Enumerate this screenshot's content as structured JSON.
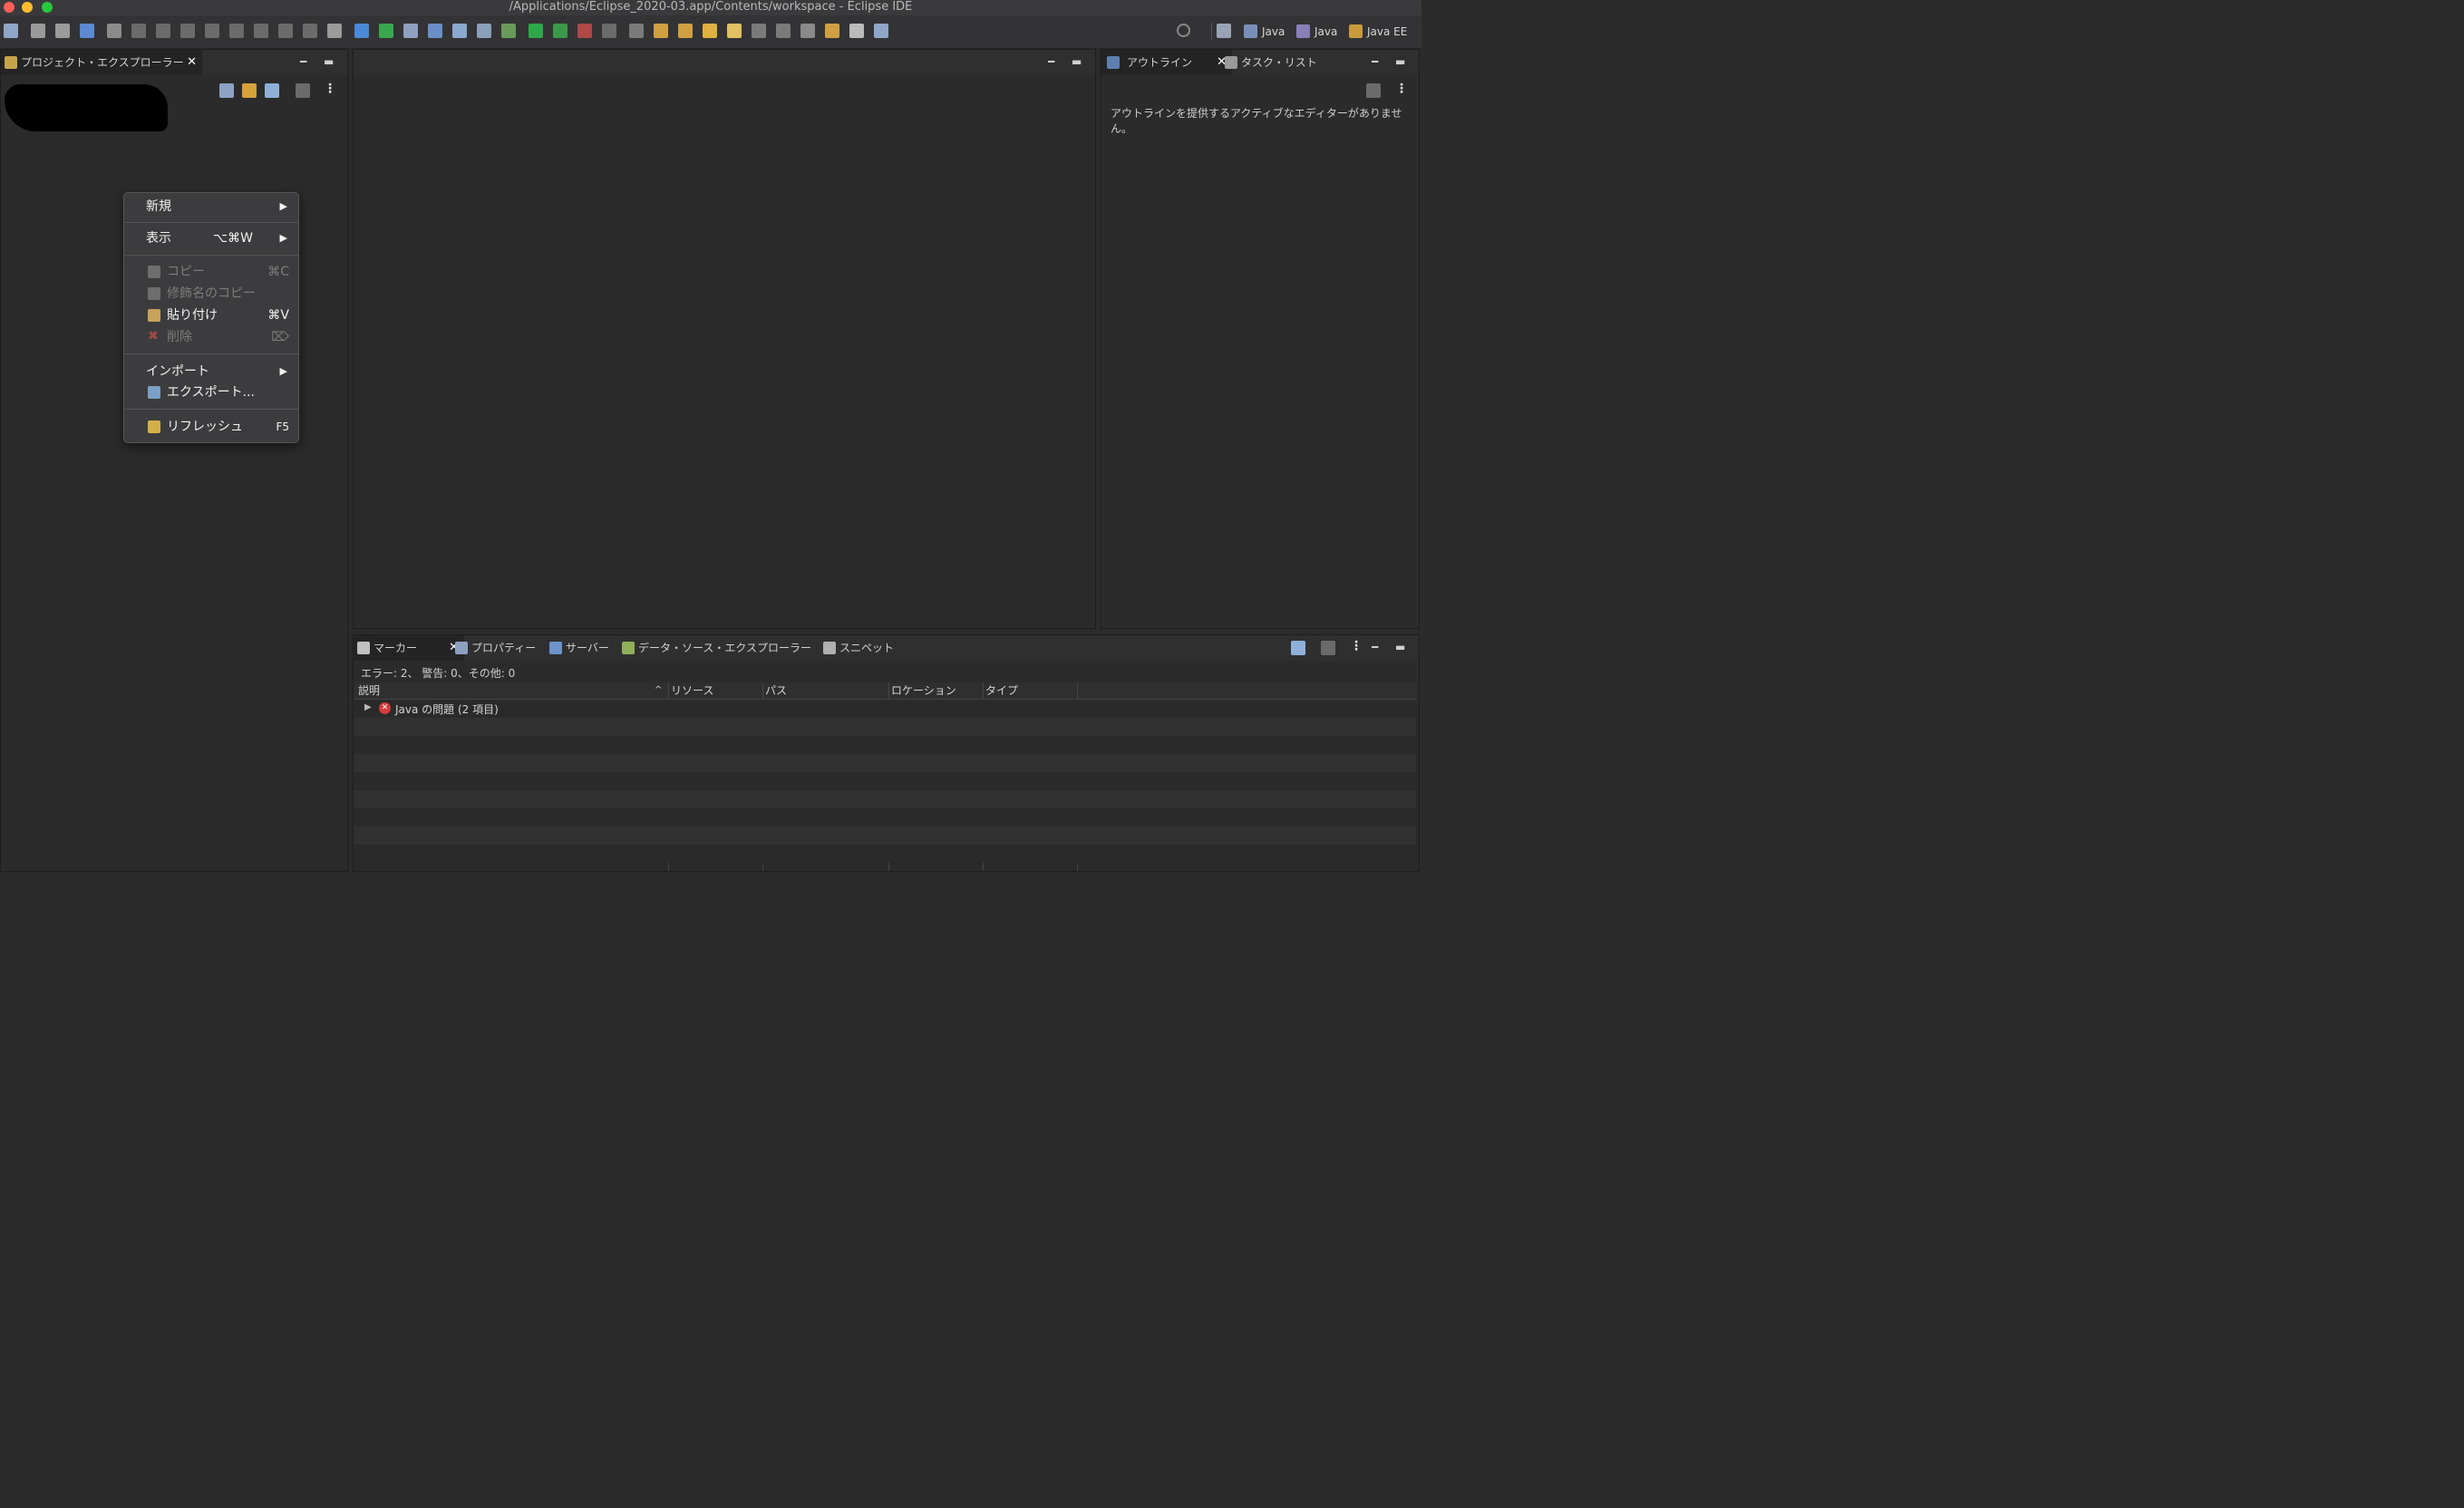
{
  "window": {
    "title": "/Applications/Eclipse_2020-03.app/Contents/workspace - Eclipse IDE"
  },
  "toolbar": {
    "perspectives": [
      {
        "label": "Java",
        "icon": "java-perspective-icon"
      },
      {
        "label": "Java",
        "icon": "java-browsing-perspective-icon"
      },
      {
        "label": "Java EE",
        "icon": "java-ee-perspective-icon"
      }
    ],
    "icons": [
      "new-icon",
      "save-icon",
      "save-all-icon",
      "toggle-icon",
      "skip-breakpoints-icon",
      "resume-icon",
      "suspend-icon",
      "terminate-icon",
      "disconnect-icon",
      "step-into-icon",
      "step-over-icon",
      "step-return-icon",
      "drop-to-frame-icon",
      "use-step-filters-icon",
      "settings-icon",
      "power-icon",
      "new-server-icon",
      "new-java-class-icon",
      "new-web-service-icon",
      "search-web-icon",
      "debug-icon",
      "run-icon",
      "coverage-icon",
      "external-tools-icon",
      "stop-icon",
      "open-type-icon",
      "open-task-icon",
      "open-folder-icon",
      "open-file-icon",
      "brush-icon",
      "next-annotation-icon",
      "prev-annotation-icon",
      "last-edit-icon",
      "back-icon",
      "forward-icon",
      "pin-icon",
      "search-icon",
      "open-perspective-icon"
    ]
  },
  "project_explorer": {
    "tab_label": "プロジェクト・エクスプローラー",
    "tools": [
      "collapse-all-icon",
      "link-with-editor-icon",
      "filter-icon",
      "focus-icon",
      "view-menu-icon"
    ]
  },
  "context_menu": {
    "items": [
      {
        "label": "新規",
        "shortcut": "",
        "submenu": true,
        "disabled": false,
        "icon": ""
      },
      {
        "label": "表示",
        "shortcut": "⌥⌘W",
        "submenu": true,
        "disabled": false,
        "icon": ""
      },
      {
        "label": "コピー",
        "shortcut": "⌘C",
        "submenu": false,
        "disabled": true,
        "icon": "copy-icon"
      },
      {
        "label": "修飾名のコピー",
        "shortcut": "",
        "submenu": false,
        "disabled": true,
        "icon": "copy-qualified-name-icon"
      },
      {
        "label": "貼り付け",
        "shortcut": "⌘V",
        "submenu": false,
        "disabled": false,
        "icon": "paste-icon"
      },
      {
        "label": "削除",
        "shortcut": "⌦",
        "submenu": false,
        "disabled": true,
        "icon": "delete-icon"
      },
      {
        "label": "インポート",
        "shortcut": "",
        "submenu": true,
        "disabled": false,
        "icon": ""
      },
      {
        "label": "エクスポート...",
        "shortcut": "",
        "submenu": false,
        "disabled": false,
        "icon": "export-icon"
      },
      {
        "label": "リフレッシュ",
        "shortcut": "F5",
        "submenu": false,
        "disabled": false,
        "icon": "refresh-icon"
      }
    ]
  },
  "outline": {
    "tabs": [
      {
        "label": "アウトライン",
        "active": true
      },
      {
        "label": "タスク・リスト",
        "active": false
      }
    ],
    "message": "アウトラインを提供するアクティブなエディターがありません。"
  },
  "markers": {
    "tabs": [
      {
        "label": "マーカー",
        "active": true,
        "icon": "markers-icon"
      },
      {
        "label": "プロパティー",
        "active": false,
        "icon": "properties-icon"
      },
      {
        "label": "サーバー",
        "active": false,
        "icon": "servers-icon"
      },
      {
        "label": "データ・ソース・エクスプローラー",
        "active": false,
        "icon": "data-source-icon"
      },
      {
        "label": "スニペット",
        "active": false,
        "icon": "snippets-icon"
      }
    ],
    "summary": "エラー: 2、 警告: 0、その他: 0",
    "columns": [
      "説明",
      "リソース",
      "パス",
      "ロケーション",
      "タイプ"
    ],
    "rows": [
      {
        "description": "Java の問題 (2 項目)",
        "resource": "",
        "path": "",
        "location": "",
        "type": ""
      }
    ]
  }
}
